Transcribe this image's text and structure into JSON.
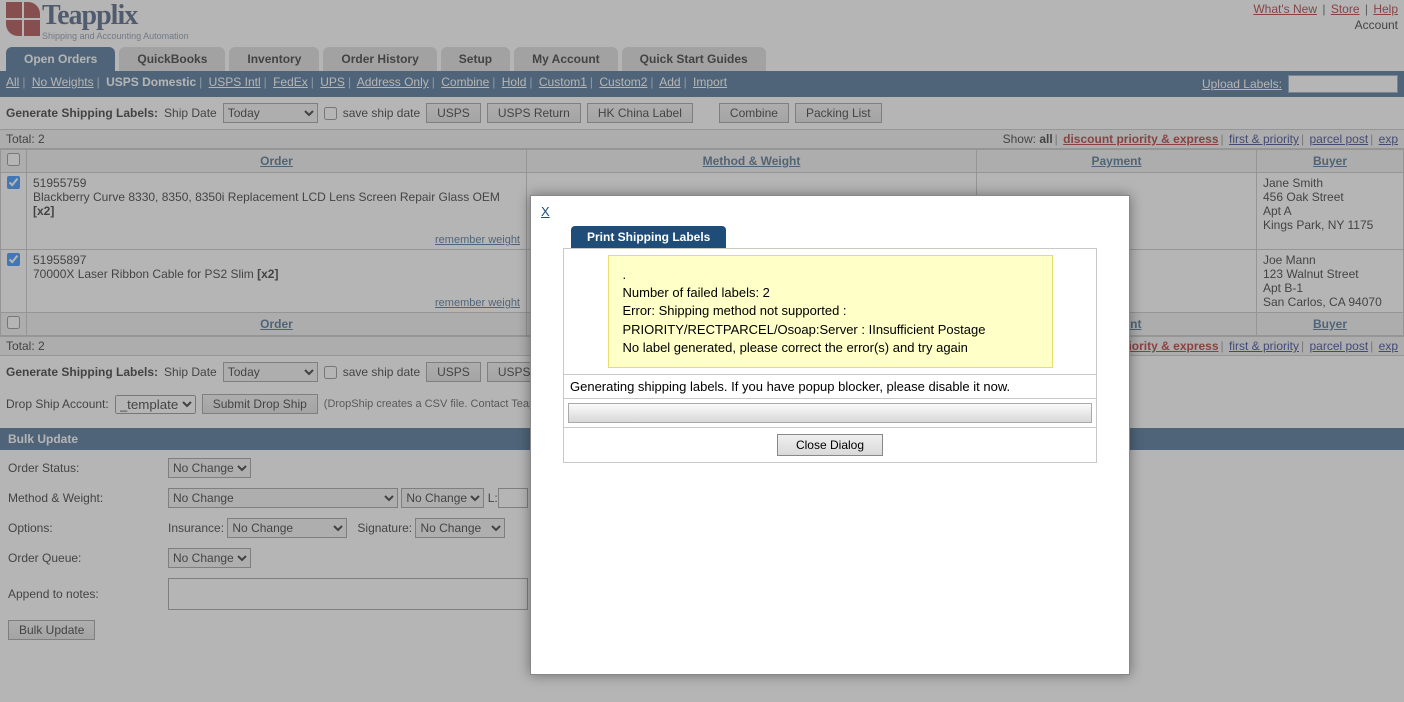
{
  "brand": {
    "name": "Teapplix",
    "tagline": "Shipping and Accounting Automation"
  },
  "toplinks": {
    "whatsnew": "What's New",
    "store": "Store",
    "help": "Help",
    "account": "Account"
  },
  "tabs": [
    "Open Orders",
    "QuickBooks",
    "Inventory",
    "Order History",
    "Setup",
    "My Account",
    "Quick Start Guides"
  ],
  "subnav": {
    "items": [
      "All",
      "No Weights",
      "USPS Domestic",
      "USPS Intl",
      "FedEx",
      "UPS",
      "Address Only",
      "Combine",
      "Hold",
      "Custom1",
      "Custom2",
      "Add",
      "Import"
    ],
    "active": "USPS Domestic",
    "uploadLabel": "Upload Labels:"
  },
  "toolbar1": {
    "label": "Generate Shipping Labels:",
    "shipDate": "Ship Date",
    "shipDateVal": "Today",
    "saveShip": "save ship date",
    "usps": "USPS",
    "uspsReturn": "USPS Return",
    "hkchina": "HK China Label",
    "combine": "Combine",
    "packing": "Packing List"
  },
  "totalRow": {
    "total": "Total:  2",
    "show": "Show:",
    "all": "all",
    "dpexp": "discount priority & express",
    "fp": "first & priority",
    "pp": "parcel post",
    "exp": "exp"
  },
  "grid": {
    "cols": {
      "order": "Order",
      "method": "Method & Weight",
      "payment": "Payment",
      "buyer": "Buyer"
    },
    "remember": "remember weight",
    "rows": [
      {
        "orderNo": "51955759",
        "item": "Blackberry Curve 8330, 8350, 8350i Replacement LCD Lens Screen Repair Glass OEM",
        "qty": "[x2]",
        "buyer": {
          "name": "Jane Smith",
          "l1": "456 Oak Street",
          "l2": "Apt A",
          "l3": "Kings Park, NY 1175"
        }
      },
      {
        "orderNo": "51955897",
        "item": "70000X Laser Ribbon Cable for PS2 Slim",
        "qty": "[x2]",
        "buyer": {
          "name": "Joe Mann",
          "l1": "123 Walnut Street",
          "l2": "Apt B-1",
          "l3": "San Carlos, CA 94070"
        }
      }
    ]
  },
  "dropship": {
    "label": "Drop Ship Account:",
    "option": "_template",
    "submit": "Submit Drop Ship",
    "note": "(DropShip creates a CSV file. Contact Teapp"
  },
  "bulk": {
    "title": "Bulk Update",
    "nochange": "No Change",
    "labels": {
      "status": "Order Status:",
      "method": "Method & Weight:",
      "options": "Options:",
      "queue": "Order Queue:",
      "notes": "Append to notes:"
    },
    "insurance": "Insurance:",
    "signature": "Signature:",
    "L": "L:",
    "submit": "Bulk Update"
  },
  "dialog": {
    "title": "Print Shipping Labels",
    "close": "Close Dialog",
    "x": "X",
    "gen": "Generating shipping labels. If you have popup blocker, please disable it now.",
    "err": {
      "l0": ".",
      "l1": "Number of failed labels: 2",
      "l2": "Error: Shipping method not supported :",
      "l3": "PRIORITY/RECTPARCEL/Osoap:Server : IInsufficient Postage",
      "l4": "No label generated, please correct the error(s) and try again"
    }
  }
}
